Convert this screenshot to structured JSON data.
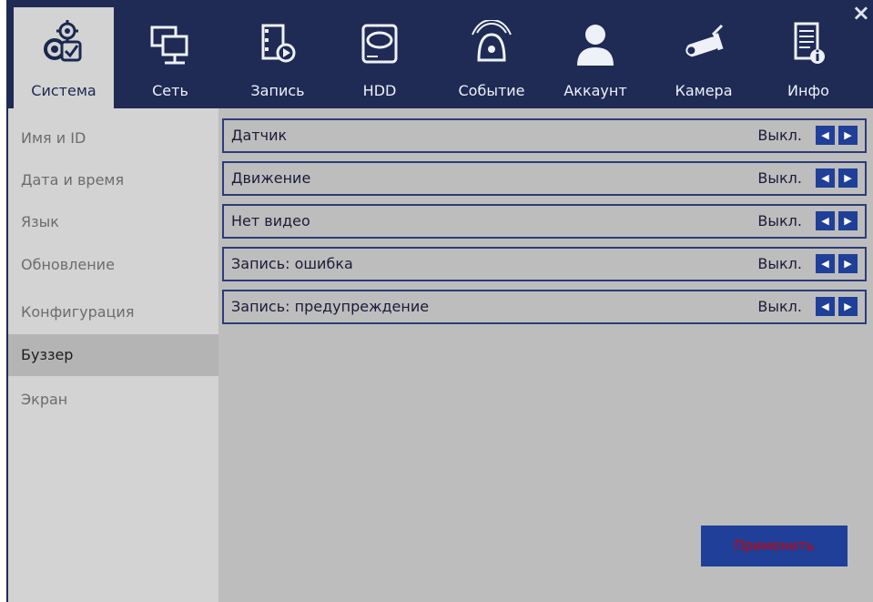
{
  "close_icon": "×",
  "tabs": [
    {
      "label": "Система",
      "icon": "gears-check-icon"
    },
    {
      "label": "Сеть",
      "icon": "network-icon"
    },
    {
      "label": "Запись",
      "icon": "film-record-icon"
    },
    {
      "label": "HDD",
      "icon": "hdd-icon"
    },
    {
      "label": "Событие",
      "icon": "alarm-bell-icon"
    },
    {
      "label": "Аккаунт",
      "icon": "user-icon"
    },
    {
      "label": "Камера",
      "icon": "camera-icon"
    },
    {
      "label": "Инфо",
      "icon": "info-doc-icon"
    }
  ],
  "sidebar": {
    "items": [
      {
        "label": "Имя и ID"
      },
      {
        "label": "Дата и время"
      },
      {
        "label": "Язык"
      },
      {
        "label": "Обновление"
      },
      {
        "label": "Конфигурация"
      },
      {
        "label": "Буззер"
      },
      {
        "label": "Экран"
      }
    ]
  },
  "settings": [
    {
      "name": "Датчик",
      "value": "Выкл."
    },
    {
      "name": "Движение",
      "value": "Выкл."
    },
    {
      "name": "Нет видео",
      "value": "Выкл."
    },
    {
      "name": "Запись: ошибка",
      "value": "Выкл."
    },
    {
      "name": "Запись: предупреждение",
      "value": "Выкл."
    }
  ],
  "arrows": {
    "left": "◀",
    "right": "▶"
  },
  "apply_label": "Применить",
  "colors": {
    "accent": "#1f3f98",
    "apply_text": "#d40000",
    "header": "#1f2a55"
  }
}
